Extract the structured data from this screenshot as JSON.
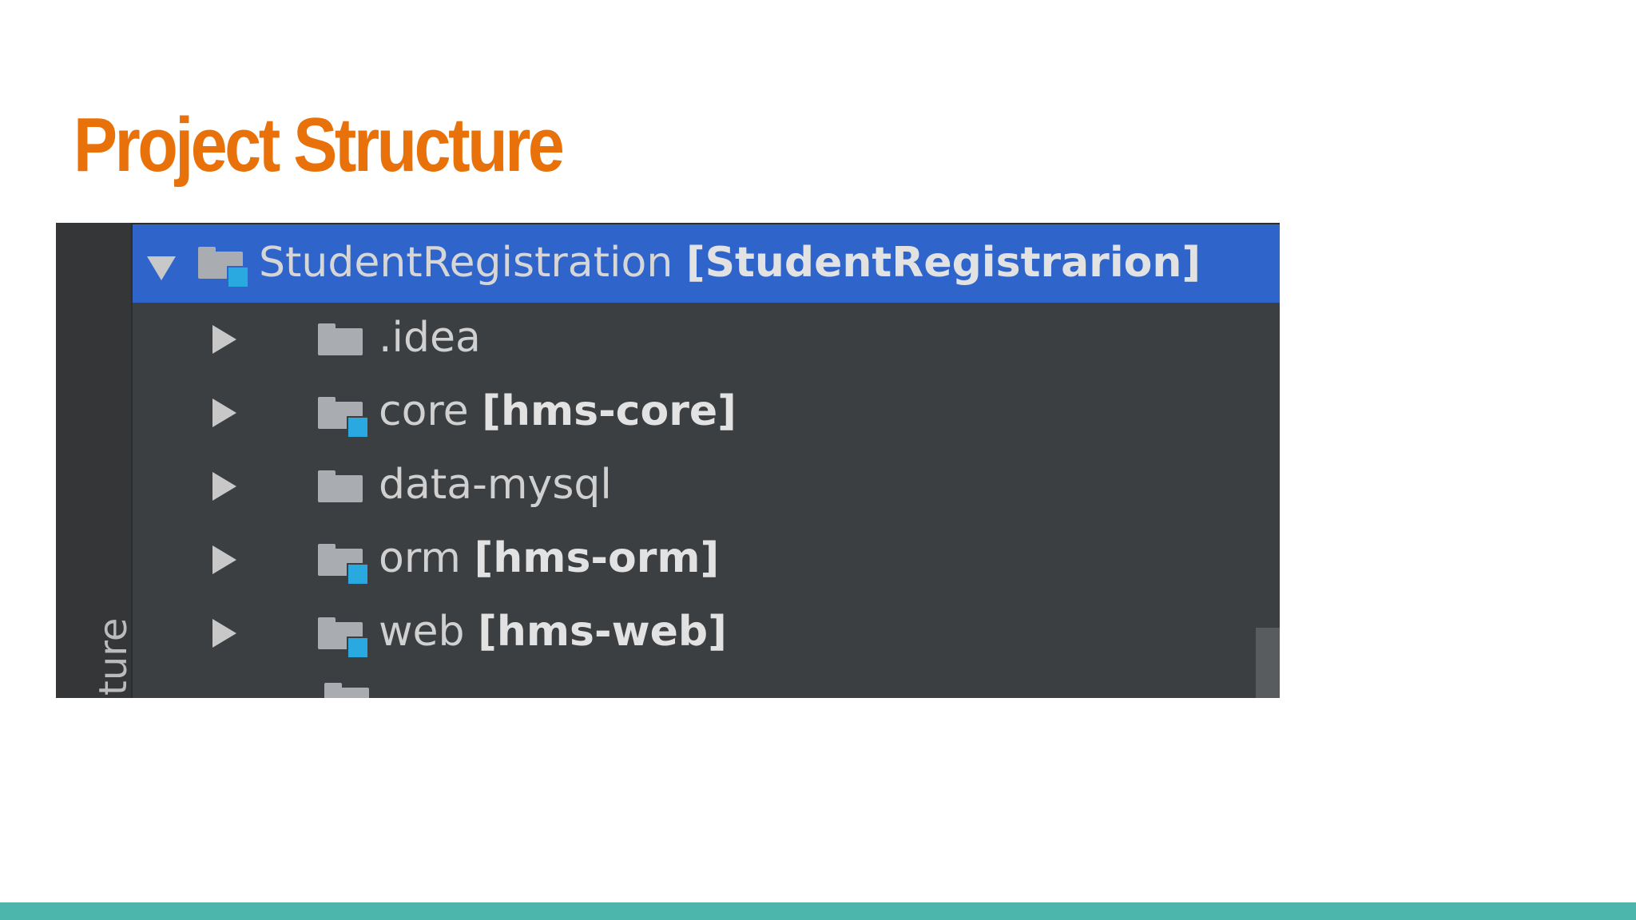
{
  "slide": {
    "title": "Project Structure",
    "title_color": "#e8710a",
    "accent_bar_color": "#4db6ac"
  },
  "ide": {
    "side_tab_label": "ture",
    "tree": {
      "root": {
        "name": "StudentRegistration",
        "module": "[StudentRegistrarion]",
        "expanded": true,
        "selected": true,
        "icon": "module-folder-icon"
      },
      "children": [
        {
          "name": ".idea",
          "module": "",
          "icon": "folder-icon",
          "expanded": false
        },
        {
          "name": "core",
          "module": "[hms-core]",
          "icon": "module-folder-icon",
          "expanded": false
        },
        {
          "name": "data-mysql",
          "module": "",
          "icon": "folder-icon",
          "expanded": false
        },
        {
          "name": "orm",
          "module": "[hms-orm]",
          "icon": "module-folder-icon",
          "expanded": false
        },
        {
          "name": "web",
          "module": "[hms-web]",
          "icon": "module-folder-icon",
          "expanded": false
        }
      ]
    },
    "colors": {
      "panel_bg": "#3c3f41",
      "selection": "#2f65ca",
      "module_badge": "#2aa8e0"
    }
  }
}
